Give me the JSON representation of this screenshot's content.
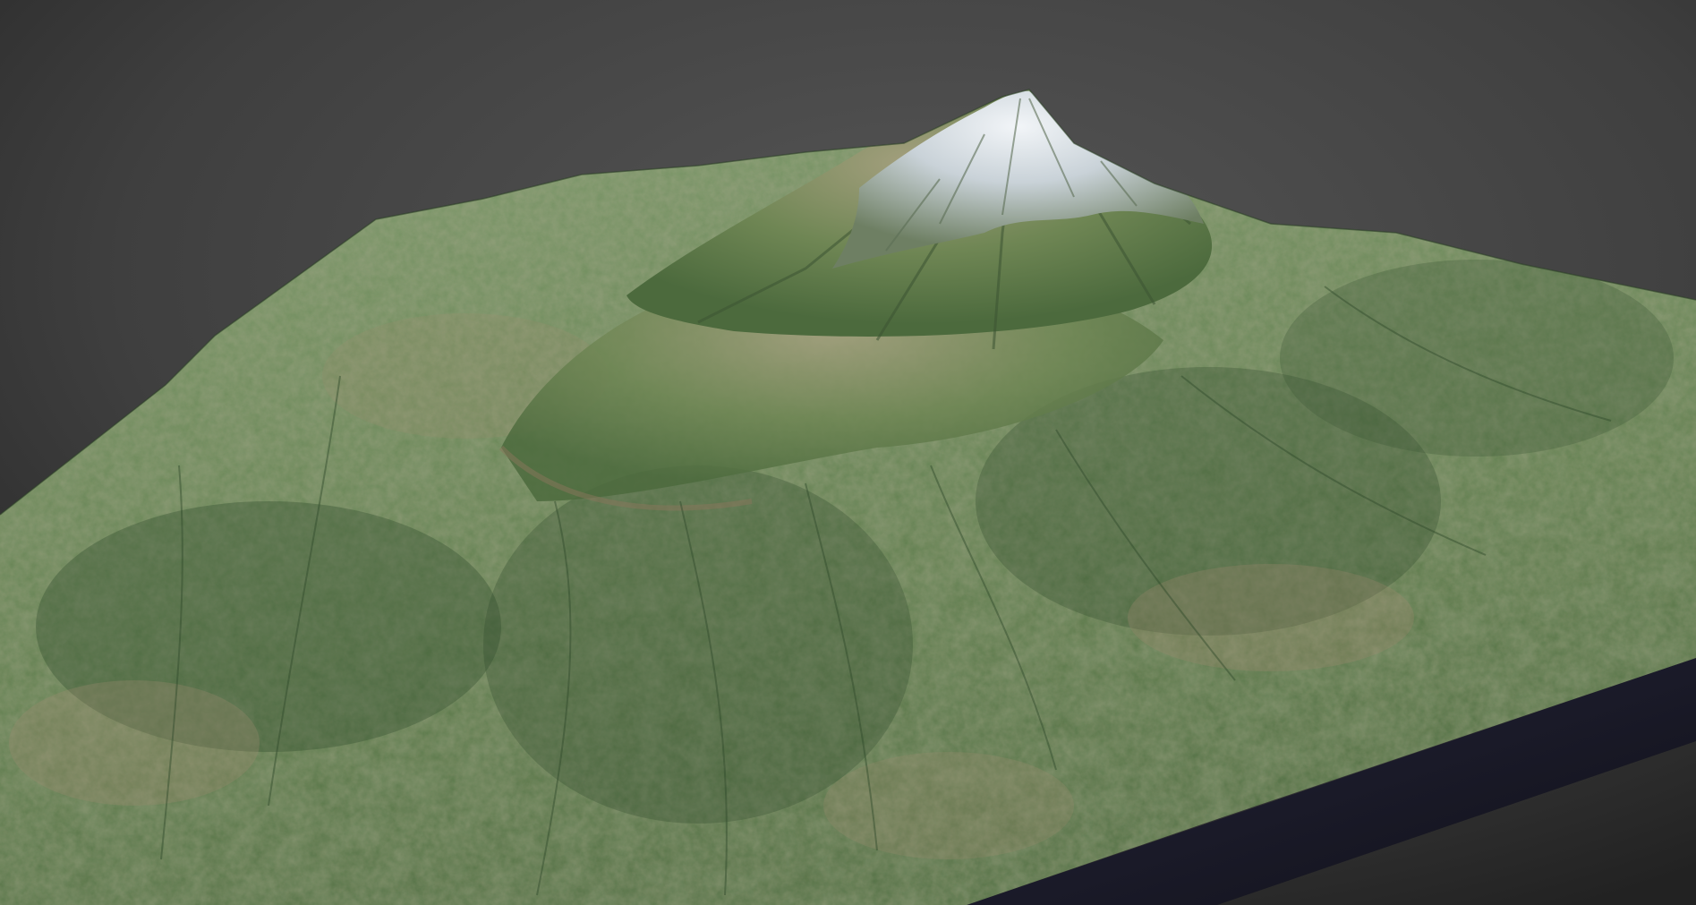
{
  "scene": {
    "subject": "terrain-render",
    "colors": {
      "background_top": "#222222",
      "background_bottom": "#5a5a5a",
      "grass_light": "#7d9a6a",
      "grass_mid": "#5f7f4e",
      "grass_dark": "#34502f",
      "dirt": "#a08a70",
      "rock": "#9a8f78",
      "snow": "#e6ecf2",
      "side_wall": "#1b1b2c"
    }
  }
}
